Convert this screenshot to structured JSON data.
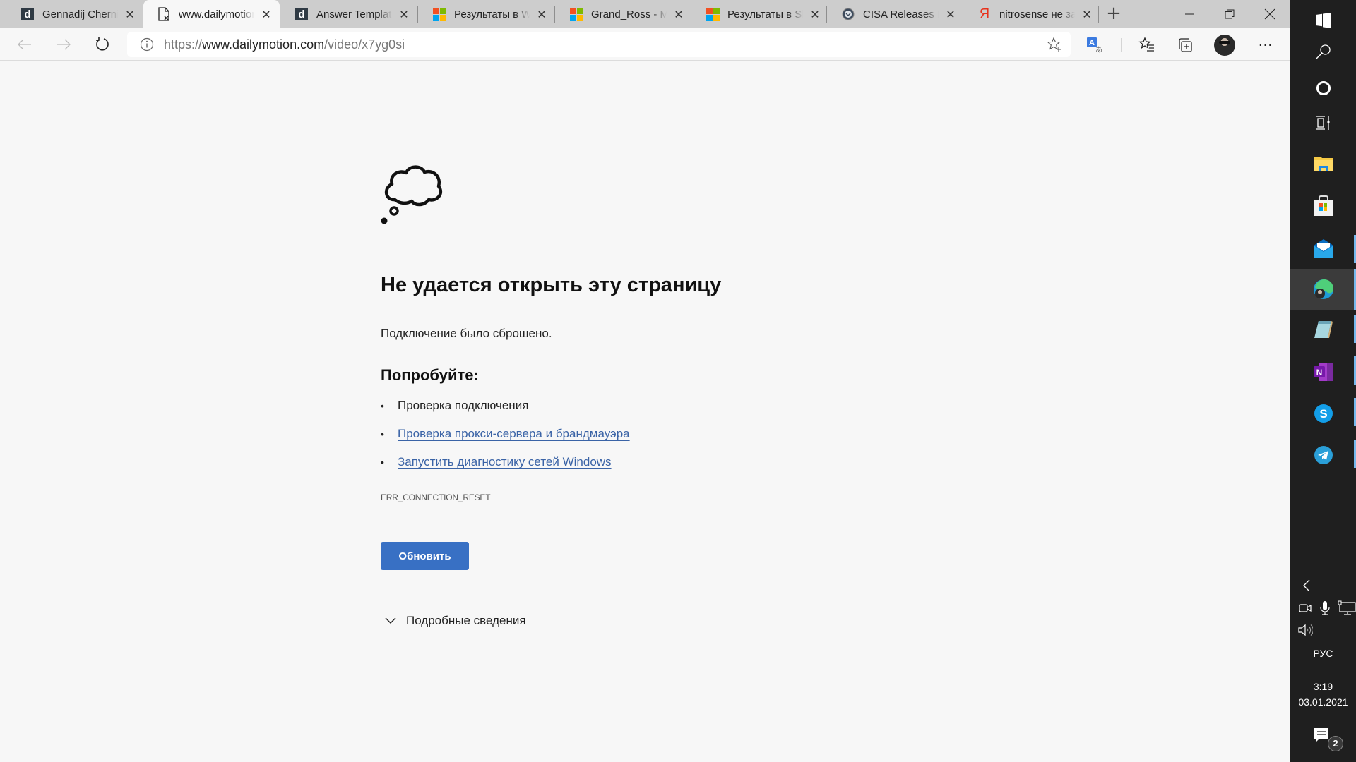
{
  "browser": {
    "tabs": [
      {
        "title": "Gennadij Chernikov",
        "favicon": "dailymotion-icon",
        "active": false
      },
      {
        "title": "www.dailymotion.com",
        "favicon": "broken-page-icon",
        "active": true
      },
      {
        "title": "Answer Template",
        "favicon": "dailymotion-icon",
        "active": false
      },
      {
        "title": "Результаты в Windows",
        "favicon": "microsoft-icon",
        "active": false
      },
      {
        "title": "Grand_Ross - Microsoft",
        "favicon": "microsoft-icon",
        "active": false
      },
      {
        "title": "Результаты в Skype",
        "favicon": "microsoft-icon",
        "active": false
      },
      {
        "title": "CISA Releases Free",
        "favicon": "dhs-seal-icon",
        "active": false
      },
      {
        "title": "nitrosense не запускается",
        "favicon": "yandex-icon",
        "active": false
      }
    ],
    "tab_close_glyph": "✕",
    "new_tab_glyph": "+",
    "address": {
      "scheme": "https://",
      "host": "www.dailymotion.com",
      "path": "/video/x7yg0si"
    },
    "more_glyph": "···"
  },
  "page": {
    "heading": "Не удается открыть эту страницу",
    "subtitle": "Подключение было сброшено.",
    "try_heading": "Попробуйте:",
    "suggestions": [
      {
        "text": "Проверка подключения",
        "link": false
      },
      {
        "text": "Проверка прокси-сервера и брандмауэра",
        "link": true
      },
      {
        "text": "Запустить диагностику сетей Windows",
        "link": true
      }
    ],
    "error_code": "ERR_CONNECTION_RESET",
    "refresh_button": "Обновить",
    "details_toggle": "Подробные сведения",
    "colors": {
      "button": "#3870c4",
      "link": "#3a63a6"
    }
  },
  "taskbar": {
    "pinned": [
      "start",
      "search",
      "cortana",
      "task-view",
      "file-explorer",
      "microsoft-store",
      "mail",
      "edge",
      "notepad",
      "onenote",
      "skype",
      "telegram"
    ],
    "active": "edge",
    "language": "РУС",
    "time": "3:19",
    "date": "03.01.2021",
    "notification_count": "2"
  }
}
